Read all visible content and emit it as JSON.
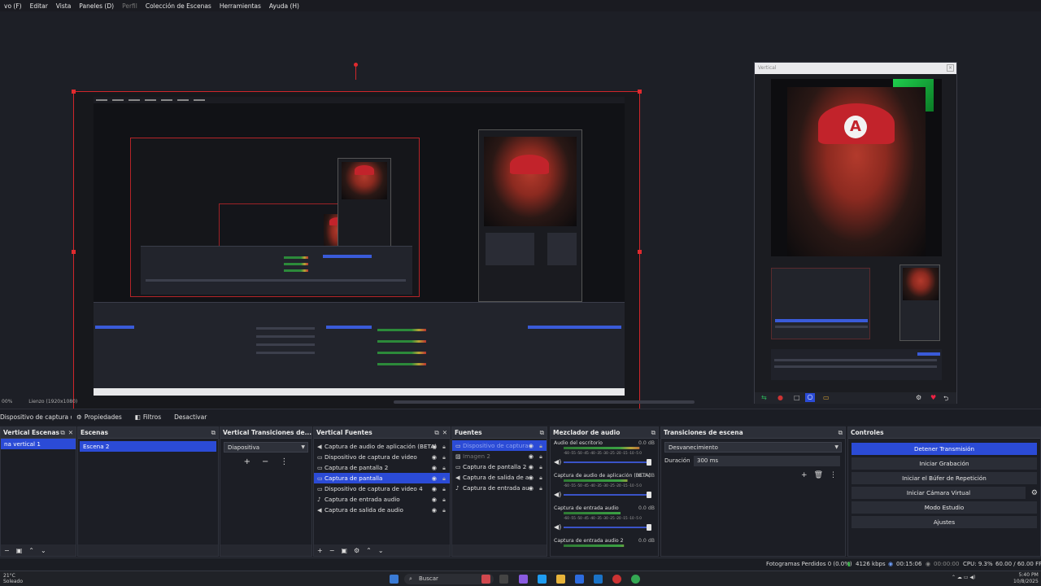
{
  "menu": {
    "items": [
      "vo (F)",
      "Editar",
      "Vista",
      "Paneles (D)",
      "Perfil",
      "Colección de Escenas",
      "Herramientas",
      "Ayuda (H)"
    ]
  },
  "vertical_window": {
    "title": "Vertical"
  },
  "preview_status": {
    "zoom": "00%",
    "canvas_label": "Lienzo (1920x1080)"
  },
  "source_toolbar": {
    "selected_source": "Dispositivo de captura de v",
    "properties": "Propiedades",
    "filters": "Filtros",
    "deactivate": "Desactivar"
  },
  "docks": {
    "vertical_scenes": {
      "title": "Vertical Escenas",
      "items": [
        "na vertical 1"
      ]
    },
    "scenes": {
      "title": "Escenas",
      "items": [
        "Escena 2"
      ]
    },
    "vertical_transitions": {
      "title": "Vertical Transiciones de...",
      "selected": "Diapositiva"
    },
    "vertical_sources": {
      "title": "Vertical Fuentes",
      "items": [
        {
          "label": "Captura de audio de aplicación (BETA)",
          "icon": "speaker-icon",
          "selected": false
        },
        {
          "label": "Dispositivo de captura de video",
          "icon": "camera-icon",
          "selected": false
        },
        {
          "label": "Captura de pantalla 2",
          "icon": "monitor-icon",
          "selected": false
        },
        {
          "label": "Captura de pantalla",
          "icon": "monitor-icon",
          "selected": true
        },
        {
          "label": "Dispositivo de captura de video 4",
          "icon": "camera-icon",
          "selected": false
        },
        {
          "label": "Captura de entrada audio",
          "icon": "microphone-icon",
          "selected": false
        },
        {
          "label": "Captura de salida de audio",
          "icon": "speaker-icon",
          "selected": false
        }
      ]
    },
    "sources": {
      "title": "Fuentes",
      "items": [
        {
          "label": "Dispositivo de captura",
          "icon": "camera-icon",
          "selected": true,
          "dim": true
        },
        {
          "label": "Imagen 2",
          "icon": "image-icon",
          "selected": false,
          "dim": true
        },
        {
          "label": "Captura de pantalla 2",
          "icon": "monitor-icon",
          "selected": false
        },
        {
          "label": "Captura de salida de a",
          "icon": "speaker-icon",
          "selected": false
        },
        {
          "label": "Captura de entrada au",
          "icon": "microphone-icon",
          "selected": false
        }
      ]
    },
    "mixer": {
      "title": "Mezclador de audio",
      "scale": "-60 -55 -50 -45 -40 -35 -30 -25 -20 -15 -10 -5 0",
      "channels": [
        {
          "name": "Audio del escritorio",
          "db": "0.0 dB",
          "level": 0.88
        },
        {
          "name": "Captura de audio de aplicación (BETA)",
          "db": "0.0 dB",
          "level": 0.74
        },
        {
          "name": "Captura de entrada audio",
          "db": "0.0 dB",
          "level": 0.66
        },
        {
          "name": "Captura de entrada audio 2",
          "db": "0.0 dB",
          "level": 0.7
        }
      ]
    },
    "transitions": {
      "title": "Transiciones de escena",
      "selected": "Desvanecimiento",
      "duration_label": "Duración",
      "duration": "300 ms"
    },
    "controls": {
      "title": "Controles",
      "buttons": [
        "Detener Transmisión",
        "Iniciar Grabación",
        "Iniciar el Búfer de Repetición",
        "Iniciar Cámara Virtual",
        "Modo Estudio",
        "Ajustes"
      ]
    }
  },
  "status": {
    "dropped": "Fotogramas Perdidos 0 (0.0%)",
    "bitrate": "4126 kbps",
    "stream_time": "00:15:06",
    "rec_time": "00:00:00",
    "cpu": "CPU: 9.3%",
    "fps": "60.00 / 60.00 FPS"
  },
  "taskbar": {
    "weather_temp": "21°C",
    "weather_desc": "Soleado",
    "search": "Buscar",
    "time": "5:40 PM",
    "date": "10/8/2025"
  },
  "colors": {
    "accent": "#2b4bd6",
    "selection_red": "#d0262a",
    "panel": "#262830"
  }
}
